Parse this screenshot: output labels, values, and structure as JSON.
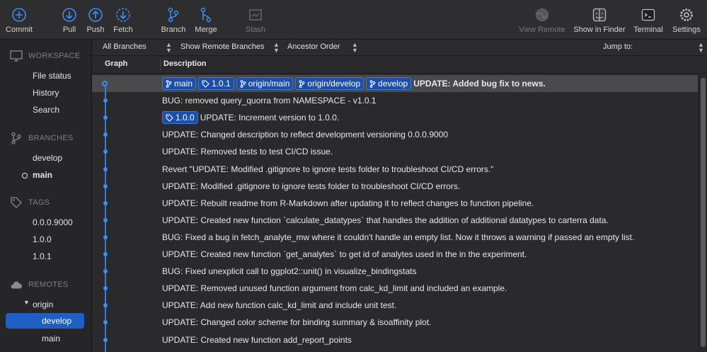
{
  "toolbar": {
    "commit": "Commit",
    "pull": "Pull",
    "push": "Push",
    "fetch": "Fetch",
    "branch": "Branch",
    "merge": "Merge",
    "stash": "Stash",
    "view_remote": "View Remote",
    "show_in_finder": "Show in Finder",
    "terminal": "Terminal",
    "settings": "Settings"
  },
  "sidebar": {
    "workspace": {
      "heading": "WORKSPACE",
      "items": [
        "File status",
        "History",
        "Search"
      ]
    },
    "branches": {
      "heading": "BRANCHES",
      "items": [
        "develop",
        "main"
      ],
      "current": "main"
    },
    "tags": {
      "heading": "TAGS",
      "items": [
        "0.0.0.9000",
        "1.0.0",
        "1.0.1"
      ]
    },
    "remotes": {
      "heading": "REMOTES",
      "remote": "origin",
      "branches": [
        "develop",
        "main"
      ],
      "selected": "develop"
    }
  },
  "filters": {
    "branches": "All Branches",
    "remote": "Show Remote Branches",
    "order": "Ancestor Order",
    "jump_to": "Jump to:"
  },
  "columns": {
    "graph": "Graph",
    "description": "Description"
  },
  "commits": [
    {
      "refs": [
        {
          "kind": "branch",
          "label": "main"
        },
        {
          "kind": "tag",
          "label": "1.0.1"
        },
        {
          "kind": "branch",
          "label": "origin/main"
        },
        {
          "kind": "branch",
          "label": "origin/develop"
        },
        {
          "kind": "branch",
          "label": "develop"
        }
      ],
      "message": "UPDATE: Added bug fix to news.",
      "selected": true
    },
    {
      "refs": [],
      "message": "BUG: removed query_quorra from NAMESPACE - v1.0.1"
    },
    {
      "refs": [
        {
          "kind": "tag",
          "label": "1.0.0"
        }
      ],
      "message": "UPDATE: Increment version to 1.0.0."
    },
    {
      "refs": [],
      "message": "UPDATE: Changed description to reflect development versioning 0.0.0.9000"
    },
    {
      "refs": [],
      "message": "UPDATE: Removed tests to test CI/CD issue."
    },
    {
      "refs": [],
      "message": "Revert \"UPDATE: Modified .gitignore to ignore tests folder to troubleshoot CI/CD errors.\""
    },
    {
      "refs": [],
      "message": "UPDATE: Modified .gitignore to ignore tests folder to troubleshoot CI/CD errors."
    },
    {
      "refs": [],
      "message": "UPDATE: Rebuilt readme from R-Markdown after updating it to reflect changes to function pipeline."
    },
    {
      "refs": [],
      "message": "UPDATE: Created new function `calculate_datatypes` that handles the addition of additional datatypes to carterra data."
    },
    {
      "refs": [],
      "message": "BUG: Fixed a bug in fetch_analyte_mw where it couldn't handle an empty list. Now it throws a warning if passed an empty list."
    },
    {
      "refs": [],
      "message": "UPDATE: Created new function `get_analytes` to get id of analytes used in the in the experiment."
    },
    {
      "refs": [],
      "message": "BUG: Fixed unexplicit call to ggplot2::unit() in visualize_bindingstats"
    },
    {
      "refs": [],
      "message": "UPDATE: Removed unused function argument from calc_kd_limit and included an example."
    },
    {
      "refs": [],
      "message": "UPDATE: Add new function calc_kd_limit and include unit test."
    },
    {
      "refs": [],
      "message": "UPDATE: Changed color scheme for binding summary & isoaffinity plot."
    },
    {
      "refs": [],
      "message": "UPDATE: Created new function add_report_points"
    }
  ],
  "colors": {
    "accent": "#1f5fc4",
    "graph": "#2f7fe8",
    "tag_bg": "#1d4fa8"
  }
}
